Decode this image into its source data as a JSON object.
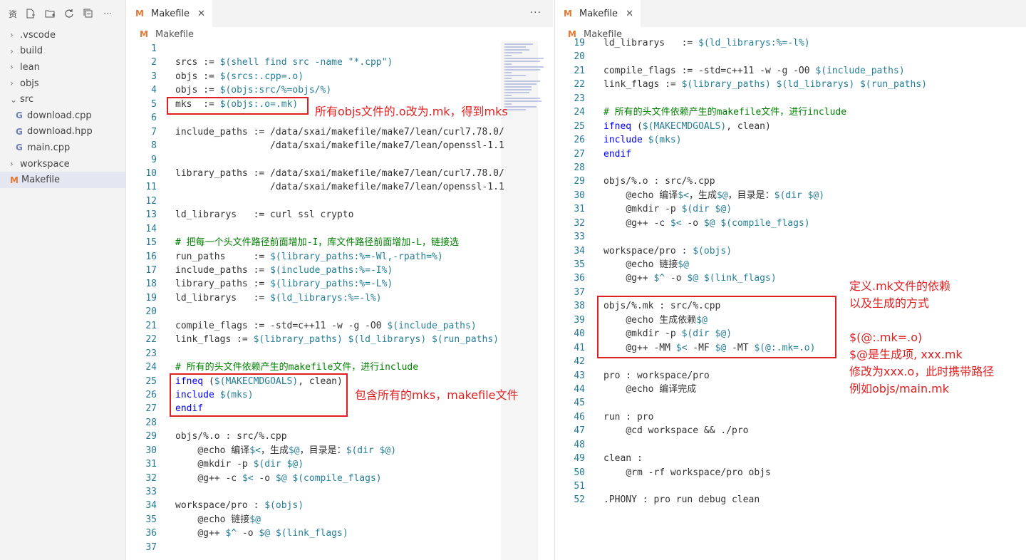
{
  "sidebar": {
    "title_glyph": "资",
    "toolbar_icons": [
      "new-file-icon",
      "new-folder-icon",
      "refresh-icon",
      "collapse-all-icon",
      "more-icon"
    ],
    "items": [
      {
        "label": ".vscode",
        "type": "folder",
        "expanded": false
      },
      {
        "label": "build",
        "type": "folder",
        "expanded": false
      },
      {
        "label": "lean",
        "type": "folder",
        "expanded": false
      },
      {
        "label": "objs",
        "type": "folder",
        "expanded": false
      },
      {
        "label": "src",
        "type": "folder",
        "expanded": true
      },
      {
        "label": "download.cpp",
        "type": "cpp",
        "child": true
      },
      {
        "label": "download.hpp",
        "type": "cpp",
        "child": true
      },
      {
        "label": "main.cpp",
        "type": "cpp",
        "child": true
      },
      {
        "label": "workspace",
        "type": "folder",
        "expanded": false
      },
      {
        "label": "Makefile",
        "type": "makefile",
        "selected": true
      }
    ]
  },
  "left_editor": {
    "tab_label": "Makefile",
    "breadcrumb": "Makefile",
    "more_label": "···",
    "lines": [
      {
        "n": "1",
        "t": ""
      },
      {
        "n": "2",
        "t": "srcs := $(shell find src -name \"*.cpp\")"
      },
      {
        "n": "3",
        "t": "objs := $(srcs:.cpp=.o)"
      },
      {
        "n": "4",
        "t": "objs := $(objs:src/%=objs/%)"
      },
      {
        "n": "5",
        "t": "mks  := $(objs:.o=.mk)"
      },
      {
        "n": "6",
        "t": ""
      },
      {
        "n": "7",
        "t": "include_paths := /data/sxai/makefile/make7/lean/curl7.78.0/"
      },
      {
        "n": "8",
        "t": "                 /data/sxai/makefile/make7/lean/openssl-1.1"
      },
      {
        "n": "9",
        "t": ""
      },
      {
        "n": "10",
        "t": "library_paths := /data/sxai/makefile/make7/lean/curl7.78.0/"
      },
      {
        "n": "11",
        "t": "                 /data/sxai/makefile/make7/lean/openssl-1.1"
      },
      {
        "n": "12",
        "t": ""
      },
      {
        "n": "13",
        "t": "ld_librarys   := curl ssl crypto"
      },
      {
        "n": "14",
        "t": ""
      },
      {
        "n": "15",
        "t": "# 把每一个头文件路径前面增加-I，库文件路径前面增加-L，链接选"
      },
      {
        "n": "16",
        "t": "run_paths     := $(library_paths:%=-Wl,-rpath=%)"
      },
      {
        "n": "17",
        "t": "include_paths := $(include_paths:%=-I%)"
      },
      {
        "n": "18",
        "t": "library_paths := $(library_paths:%=-L%)"
      },
      {
        "n": "19",
        "t": "ld_librarys   := $(ld_librarys:%=-l%)"
      },
      {
        "n": "20",
        "t": ""
      },
      {
        "n": "21",
        "t": "compile_flags := -std=c++11 -w -g -O0 $(include_paths)"
      },
      {
        "n": "22",
        "t": "link_flags := $(library_paths) $(ld_librarys) $(run_paths)"
      },
      {
        "n": "23",
        "t": ""
      },
      {
        "n": "24",
        "t": "# 所有的头文件依赖产生的makefile文件，进行include"
      },
      {
        "n": "25",
        "t": "ifneq ($(MAKECMDGOALS), clean)"
      },
      {
        "n": "26",
        "t": "include $(mks)"
      },
      {
        "n": "27",
        "t": "endif"
      },
      {
        "n": "28",
        "t": ""
      },
      {
        "n": "29",
        "t": "objs/%.o : src/%.cpp"
      },
      {
        "n": "30",
        "t": "    @echo 编译$<，生成$@，目录是：$(dir $@)"
      },
      {
        "n": "31",
        "t": "    @mkdir -p $(dir $@)"
      },
      {
        "n": "32",
        "t": "    @g++ -c $< -o $@ $(compile_flags)"
      },
      {
        "n": "33",
        "t": ""
      },
      {
        "n": "34",
        "t": "workspace/pro : $(objs)"
      },
      {
        "n": "35",
        "t": "    @echo 链接$@"
      },
      {
        "n": "36",
        "t": "    @g++ $^ -o $@ $(link_flags)"
      },
      {
        "n": "37",
        "t": ""
      }
    ]
  },
  "right_editor": {
    "tab_label": "Makefile",
    "breadcrumb": "Makefile",
    "lines": [
      {
        "n": "19",
        "t": "ld_librarys   := $(ld_librarys:%=-l%)"
      },
      {
        "n": "20",
        "t": ""
      },
      {
        "n": "21",
        "t": "compile_flags := -std=c++11 -w -g -O0 $(include_paths)"
      },
      {
        "n": "22",
        "t": "link_flags := $(library_paths) $(ld_librarys) $(run_paths)"
      },
      {
        "n": "23",
        "t": ""
      },
      {
        "n": "24",
        "t": "# 所有的头文件依赖产生的makefile文件，进行include"
      },
      {
        "n": "25",
        "t": "ifneq ($(MAKECMDGOALS), clean)"
      },
      {
        "n": "26",
        "t": "include $(mks)"
      },
      {
        "n": "27",
        "t": "endif"
      },
      {
        "n": "28",
        "t": ""
      },
      {
        "n": "29",
        "t": "objs/%.o : src/%.cpp"
      },
      {
        "n": "30",
        "t": "    @echo 编译$<，生成$@，目录是：$(dir $@)"
      },
      {
        "n": "31",
        "t": "    @mkdir -p $(dir $@)"
      },
      {
        "n": "32",
        "t": "    @g++ -c $< -o $@ $(compile_flags)"
      },
      {
        "n": "33",
        "t": ""
      },
      {
        "n": "34",
        "t": "workspace/pro : $(objs)"
      },
      {
        "n": "35",
        "t": "    @echo 链接$@"
      },
      {
        "n": "36",
        "t": "    @g++ $^ -o $@ $(link_flags)"
      },
      {
        "n": "37",
        "t": ""
      },
      {
        "n": "38",
        "t": "objs/%.mk : src/%.cpp"
      },
      {
        "n": "39",
        "t": "    @echo 生成依赖$@"
      },
      {
        "n": "40",
        "t": "    @mkdir -p $(dir $@)"
      },
      {
        "n": "41",
        "t": "    @g++ -MM $< -MF $@ -MT $(@:.mk=.o)"
      },
      {
        "n": "42",
        "t": ""
      },
      {
        "n": "43",
        "t": "pro : workspace/pro"
      },
      {
        "n": "44",
        "t": "    @echo 编译完成"
      },
      {
        "n": "45",
        "t": ""
      },
      {
        "n": "46",
        "t": "run : pro"
      },
      {
        "n": "47",
        "t": "    @cd workspace && ./pro"
      },
      {
        "n": "48",
        "t": ""
      },
      {
        "n": "49",
        "t": "clean :"
      },
      {
        "n": "50",
        "t": "    @rm -rf workspace/pro objs"
      },
      {
        "n": "51",
        "t": ""
      },
      {
        "n": "52",
        "t": ".PHONY : pro run debug clean"
      }
    ]
  },
  "annotations": {
    "mks_note": "所有objs文件的.o改为.mk，得到mks",
    "include_note": "包含所有的mks，makefile文件",
    "mk_rule_note": [
      "定义.mk文件的依赖",
      "以及生成的方式",
      "",
      "$(@:.mk=.o)",
      "$@是生成项, xxx.mk",
      "修改为xxx.o，此时携带路径",
      "例如objs/main.mk"
    ]
  },
  "colors": {
    "keyword": "#0000ff",
    "comment": "#008000",
    "variable": "#267f99",
    "string": "#a31515",
    "line_number": "#237893",
    "annotation_red": "#e02020",
    "makefile_icon": "#e37933"
  }
}
